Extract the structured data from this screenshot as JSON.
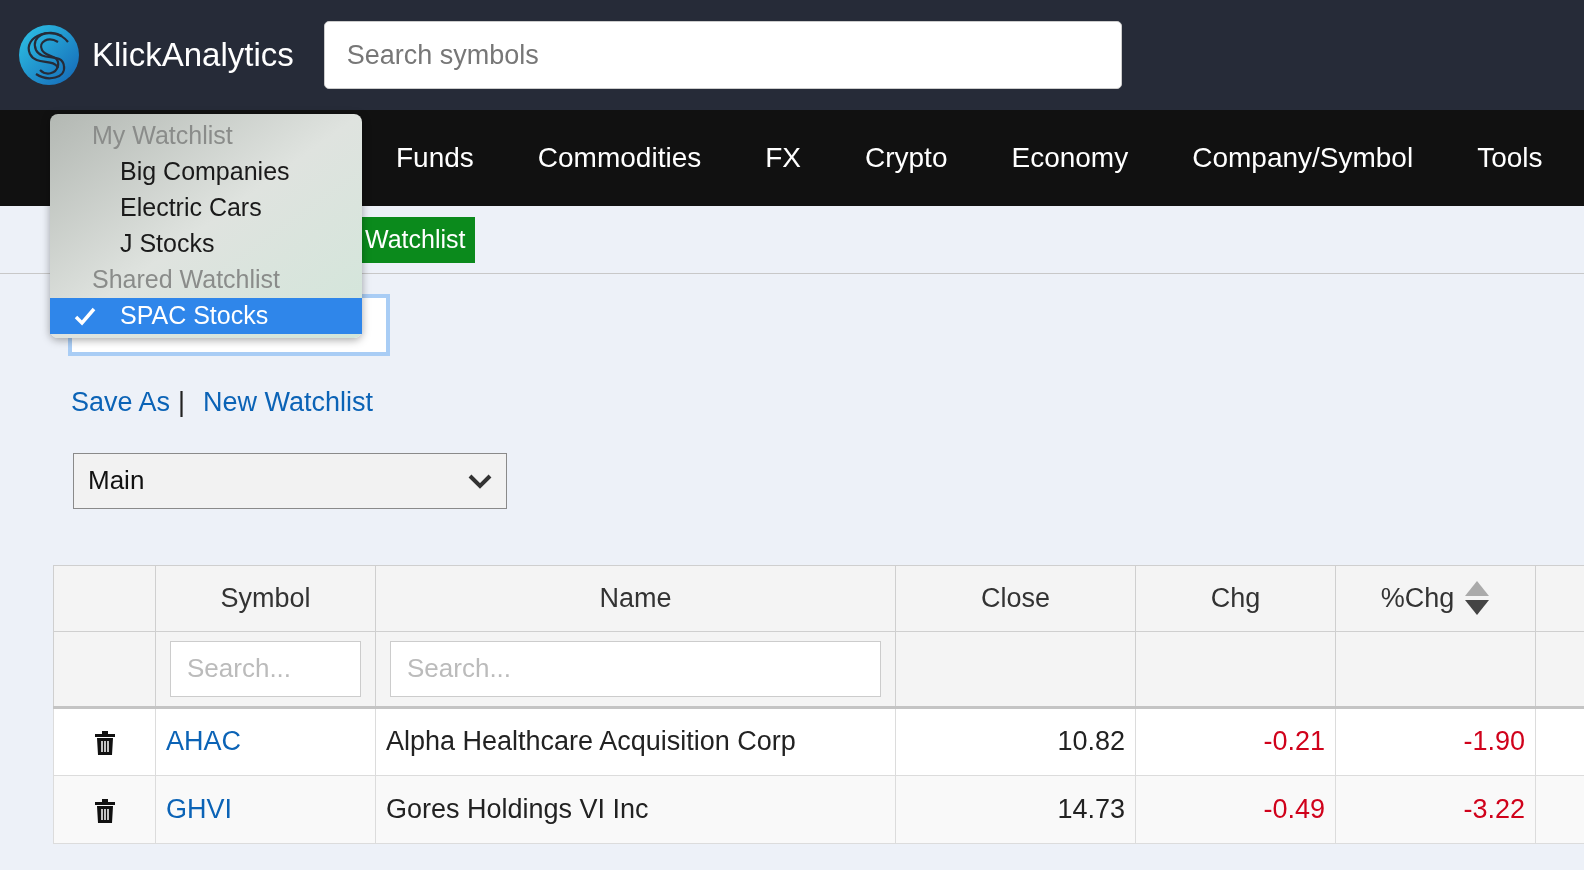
{
  "header": {
    "logo_text": "KlickAnalytics",
    "search": {
      "placeholder": "Search symbols"
    }
  },
  "nav": {
    "items": [
      "Funds",
      "Commodities",
      "FX",
      "Crypto",
      "Economy",
      "Company/Symbol",
      "Tools"
    ]
  },
  "watchlist_dropdown": {
    "groups": [
      {
        "label": "My Watchlist",
        "items": [
          {
            "label": "Big Companies",
            "selected": false
          },
          {
            "label": "Electric Cars",
            "selected": false
          },
          {
            "label": "J Stocks",
            "selected": false
          }
        ]
      },
      {
        "label": "Shared Watchlist",
        "items": [
          {
            "label": "SPAC Stocks",
            "selected": true
          }
        ]
      }
    ]
  },
  "watchlist_button": {
    "label": "Watchlist"
  },
  "links": {
    "save_as": "Save As",
    "separator": "|",
    "new_watchlist": "New Watchlist"
  },
  "view_select": {
    "value": "Main"
  },
  "table": {
    "columns": [
      {
        "label": "Symbol",
        "filter_placeholder": "Search...",
        "sorted": false
      },
      {
        "label": "Name",
        "filter_placeholder": "Search...",
        "sorted": false
      },
      {
        "label": "Close",
        "sorted": false
      },
      {
        "label": "Chg",
        "sorted": false
      },
      {
        "label": "%Chg",
        "sorted": true
      }
    ],
    "rows": [
      {
        "symbol": "AHAC",
        "name": "Alpha Healthcare Acquisition Corp",
        "close": "10.82",
        "chg": "-0.21",
        "pct_chg": "-1.90",
        "negative": true
      },
      {
        "symbol": "GHVI",
        "name": "Gores Holdings VI Inc",
        "close": "14.73",
        "chg": "-0.49",
        "pct_chg": "-3.22",
        "negative": true
      }
    ]
  }
}
